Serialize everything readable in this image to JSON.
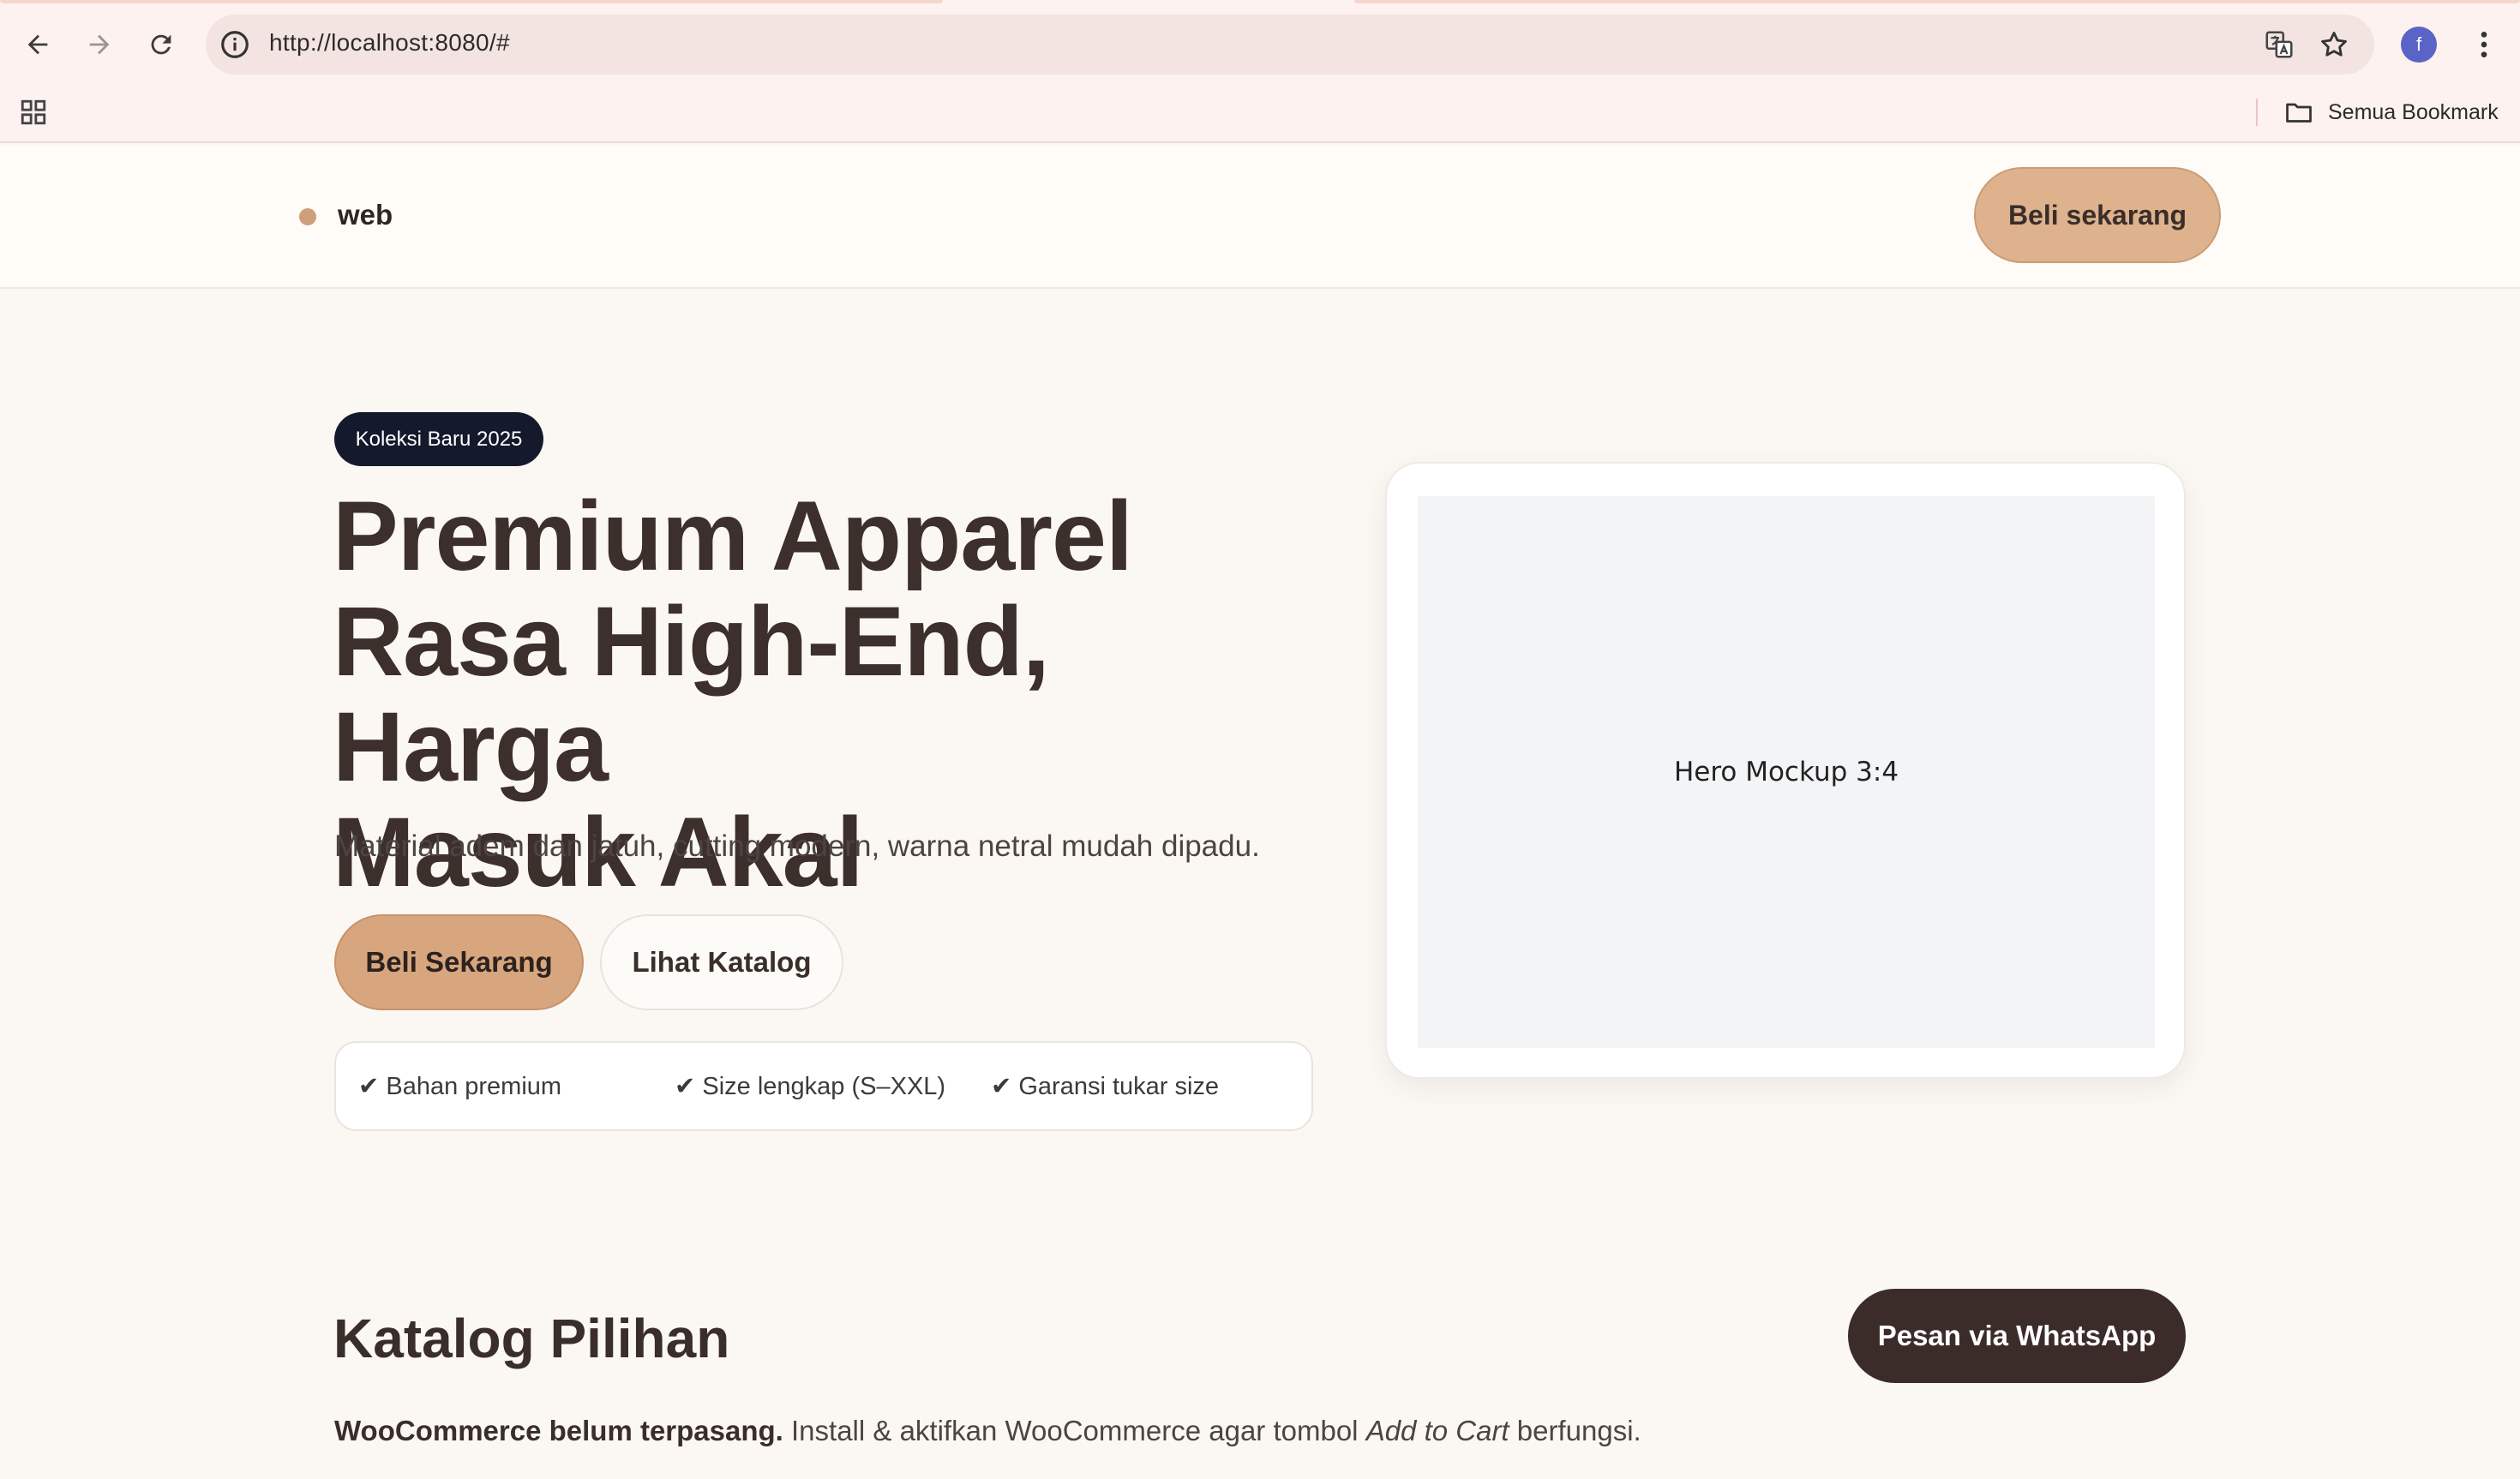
{
  "browser": {
    "url": "http://localhost:8080/#",
    "profile_initial": "f",
    "bookmarks_label": "Semua Bookmark",
    "icons": [
      "back-arrow-icon",
      "forward-arrow-icon",
      "reload-icon",
      "info-icon",
      "translate-icon",
      "star-icon",
      "more-vert-icon",
      "apps-grid-icon",
      "folder-icon"
    ]
  },
  "header": {
    "brand": "web",
    "cta": "Beli sekarang"
  },
  "hero": {
    "badge": "Koleksi Baru 2025",
    "title_line1": "Premium Apparel",
    "title_line2": "Rasa High-End, Harga",
    "title_line3": "Masuk Akal",
    "subtitle": "Material adem dan jatuh, cutting modern, warna netral mudah dipadu.",
    "primary_button": "Beli Sekarang",
    "secondary_button": "Lihat Katalog",
    "features": [
      "✔ Bahan premium",
      "✔ Size lengkap (S–XXL)",
      "✔ Garansi tukar size"
    ],
    "mockup_label": "Hero Mockup 3:4"
  },
  "catalog": {
    "title": "Katalog Pilihan",
    "whatsapp_button": "Pesan via WhatsApp",
    "notice_bold": "WooCommerce belum terpasang.",
    "notice_text1": " Install & aktifkan WooCommerce agar tombol ",
    "notice_italic": "Add to Cart",
    "notice_text2": " berfungsi."
  },
  "colors": {
    "accent": "#d8a67e",
    "badge_bg": "#141a2b",
    "heading": "#3d2f2c",
    "whatsapp_bg": "#3b2c2a",
    "page_bg": "#fbf8f4"
  }
}
